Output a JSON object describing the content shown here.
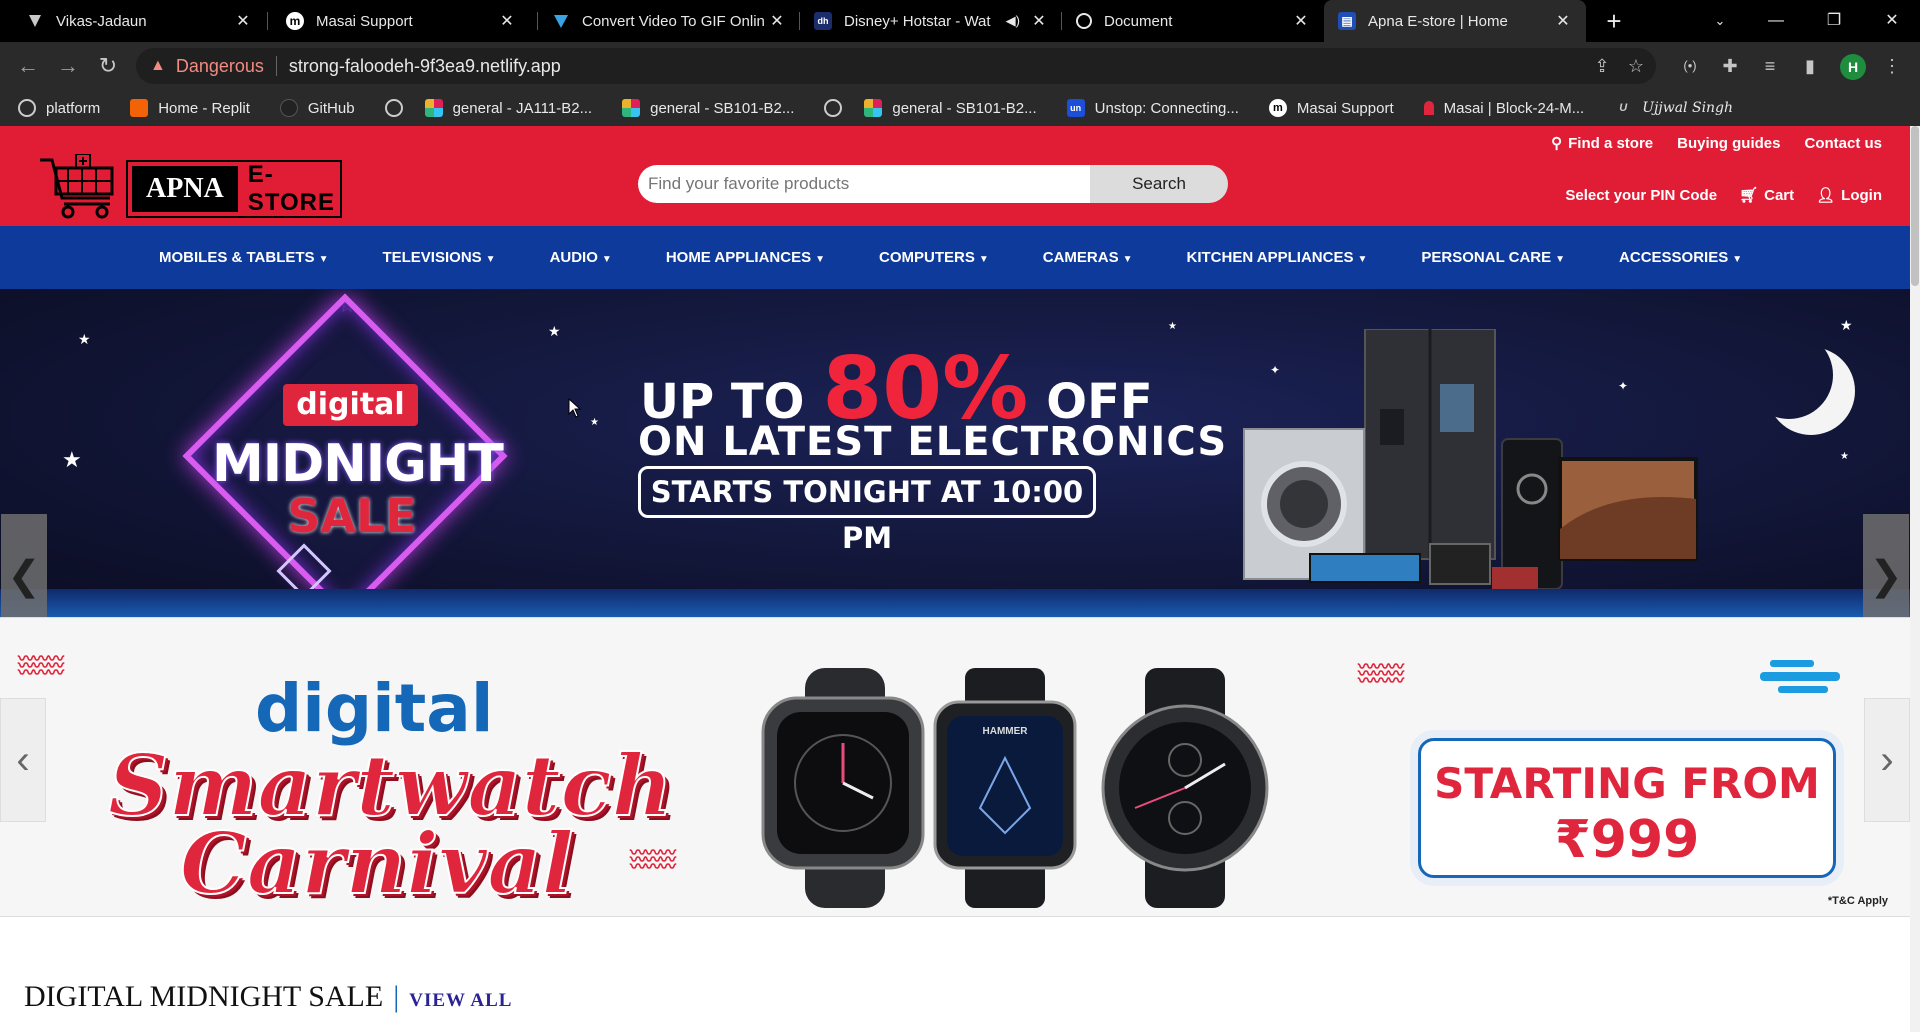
{
  "browser": {
    "tabs": [
      {
        "title": "Vikas-Jadaun",
        "icon": "replit-icon"
      },
      {
        "title": "Masai Support",
        "icon": "masai-icon"
      },
      {
        "title": "Convert Video To GIF Onlin",
        "icon": "converter-icon"
      },
      {
        "title": "Disney+ Hotstar - Wat",
        "icon": "hotstar-icon"
      },
      {
        "title": "Document",
        "icon": "globe-icon"
      },
      {
        "title": "Apna E-store | Home",
        "icon": "store-icon"
      }
    ],
    "address": {
      "security_label": "Dangerous",
      "url": "strong-faloodeh-9f3ea9.netlify.app"
    },
    "profile_initial": "H",
    "bookmarks": [
      {
        "label": "platform"
      },
      {
        "label": "Home - Replit"
      },
      {
        "label": "GitHub"
      },
      {
        "label": ""
      },
      {
        "label": "general - JA111-B2..."
      },
      {
        "label": "general - SB101-B2..."
      },
      {
        "label": ""
      },
      {
        "label": "general - SB101-B2..."
      },
      {
        "label": "Unstop: Connecting..."
      },
      {
        "label": "Masai Support"
      },
      {
        "label": "Masai | Block-24-M..."
      },
      {
        "label": "Ujjwal Singh"
      }
    ]
  },
  "header": {
    "logo_left": "APNA",
    "logo_right": "E-STORE",
    "search_placeholder": "Find your favorite products",
    "search_button": "Search",
    "top_links": {
      "find_store": "Find a store",
      "buying_guides": "Buying guides",
      "contact": "Contact us"
    },
    "user_links": {
      "pincode": "Select your PIN Code",
      "cart": "Cart",
      "login": "Login"
    }
  },
  "categories": [
    "MOBILES & TABLETS",
    "TELEVISIONS",
    "AUDIO",
    "HOME APPLIANCES",
    "COMPUTERS",
    "CAMERAS",
    "KITCHEN APPLIANCES",
    "PERSONAL CARE",
    "ACCESSORIES"
  ],
  "hero": {
    "badge": "digital",
    "midnight": "MIDNIGHT",
    "sale": "SALE",
    "upto": "UP TO",
    "discount": "80%",
    "off": "OFF",
    "subtitle": "ON LATEST ELECTRONICS",
    "starts": "STARTS TONIGHT AT 10:00 PM"
  },
  "promo": {
    "digital": "digital",
    "line1": "Smartwatch",
    "line2": "Carnival",
    "price_label": "STARTING FROM",
    "price": "₹999",
    "tnc": "*T&C Apply",
    "watch_brand": "HAMMER"
  },
  "section": {
    "title": "DIGITAL MIDNIGHT SALE",
    "link": "VIEW ALL"
  },
  "colors": {
    "header_red": "#e01d35",
    "nav_blue": "#0e3a9c",
    "accent_blue": "#1567b8"
  }
}
